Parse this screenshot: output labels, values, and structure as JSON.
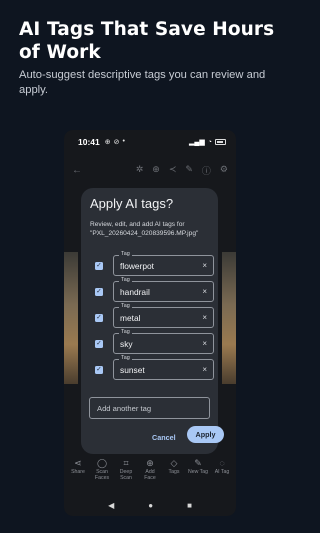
{
  "headline": "AI Tags That Save Hours of Work",
  "subline": "Auto-suggest descriptive tags you can review and apply.",
  "status_bar": {
    "time": "10:41",
    "icons": [
      "⊕",
      "⊘",
      "•"
    ],
    "signal": "▂▄▆",
    "wifi": "◔"
  },
  "toolbar": {
    "back_icon": "arrow-left-icon",
    "tools": [
      "settings-icon",
      "zoom-icon",
      "share-icon",
      "edit-icon",
      "info-icon",
      "gear-icon"
    ]
  },
  "dialog": {
    "title": "Apply AI tags?",
    "description": "Review, edit, and add AI tags for \"PXL_20260424_020839596.MP.jpg\"",
    "tag_caption": "Tag",
    "tags": [
      {
        "value": "flowerpot",
        "checked": true
      },
      {
        "value": "handrail",
        "checked": true
      },
      {
        "value": "metal",
        "checked": true
      },
      {
        "value": "sky",
        "checked": true
      },
      {
        "value": "sunset",
        "checked": true
      }
    ],
    "add_placeholder": "Add another tag",
    "cancel_label": "Cancel",
    "apply_label": "Apply"
  },
  "bottom_bar": [
    {
      "icon": "share-icon",
      "glyph": "⋖",
      "label": "Share"
    },
    {
      "icon": "scan-faces-icon",
      "glyph": "◯",
      "label": "Scan Faces"
    },
    {
      "icon": "deep-scan-icon",
      "glyph": "⌗",
      "label": "Deep Scan"
    },
    {
      "icon": "add-face-icon",
      "glyph": "⊕",
      "label": "Add Face"
    },
    {
      "icon": "tags-icon",
      "glyph": "◇",
      "label": "Tags"
    },
    {
      "icon": "new-tag-icon",
      "glyph": "✎",
      "label": "New Tag"
    },
    {
      "icon": "ai-tag-icon",
      "glyph": "◌",
      "label": "AI Tag"
    }
  ],
  "nav_bar": {
    "back": "◀",
    "home": "●",
    "recents": "■"
  },
  "colors": {
    "background": "#0e1520",
    "dialog": "#2b2f36",
    "accent": "#a9c8f5"
  }
}
